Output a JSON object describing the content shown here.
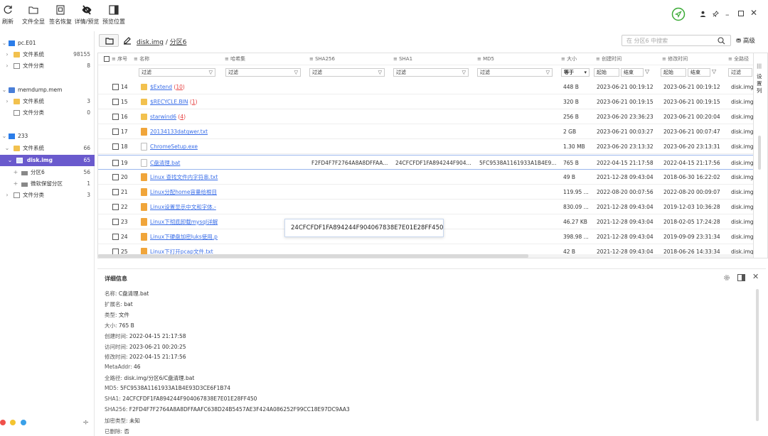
{
  "toolbar": {
    "refresh": "刷新",
    "expand_all": "文件全显",
    "signature_restore": "签名恢复",
    "details_preview": "详情/预览",
    "preview_position": "预览位置"
  },
  "sidebar": {
    "evidence": [
      {
        "name": "pc.E01",
        "children": [
          {
            "label": "文件系统",
            "count": "98155"
          },
          {
            "label": "文件分类",
            "count": "8"
          }
        ]
      },
      {
        "name": "memdump.mem",
        "children": [
          {
            "label": "文件系统",
            "count": "3"
          },
          {
            "label": "文件分类",
            "count": "0"
          }
        ]
      },
      {
        "name": "233",
        "children": [
          {
            "label": "文件系统",
            "count": "66"
          },
          {
            "label": "disk.img",
            "count": "65"
          },
          {
            "label": "分区6",
            "count": "56"
          },
          {
            "label": "微软保留分区",
            "count": "1"
          },
          {
            "label": "文件分类",
            "count": "3"
          }
        ]
      }
    ]
  },
  "path": {
    "root": "disk.img",
    "sep": " / ",
    "current": "分区6"
  },
  "search": {
    "placeholder": "在 分区6 中搜索",
    "advanced": "高级"
  },
  "grid": {
    "columns": [
      "序号",
      "名称",
      "哈希集",
      "SHA256",
      "SHA1",
      "MD5",
      "大小",
      "创建时间",
      "修改时间",
      "全路径"
    ],
    "side_label": "设置列",
    "filters": {
      "text": "过滤",
      "equals": "等于",
      "start": "起始",
      "end": "结束"
    },
    "rows": [
      {
        "no": "14",
        "name": "$Extend",
        "count": "10",
        "type": "folder",
        "sha256": "",
        "sha1": "",
        "md5": "",
        "size": "448 B",
        "created": "2023-06-21 00:19:12",
        "modified": "2023-06-21 00:19:12",
        "path": "disk.img"
      },
      {
        "no": "15",
        "name": "$RECYCLE.BIN",
        "count": "1",
        "type": "folder",
        "sha256": "",
        "sha1": "",
        "md5": "",
        "size": "320 B",
        "created": "2023-06-21 00:19:15",
        "modified": "2023-06-21 00:19:15",
        "path": "disk.img"
      },
      {
        "no": "16",
        "name": "starwind6",
        "count": "4",
        "type": "folder",
        "sha256": "",
        "sha1": "",
        "md5": "",
        "size": "256 B",
        "created": "2023-06-20 23:36:23",
        "modified": "2023-06-21 00:20:04",
        "path": "disk.img"
      },
      {
        "no": "17",
        "name": "20134133datqwer.txt",
        "count": "",
        "type": "file",
        "sha256": "",
        "sha1": "",
        "md5": "",
        "size": "2 GB",
        "created": "2023-06-21 00:03:27",
        "modified": "2023-06-21 00:07:47",
        "path": "disk.img"
      },
      {
        "no": "18",
        "name": "ChromeSetup.exe",
        "count": "",
        "type": "blank",
        "sha256": "",
        "sha1": "",
        "md5": "",
        "size": "1.30 MB",
        "created": "2023-06-20 23:13:32",
        "modified": "2023-06-20 23:13:31",
        "path": "disk.img"
      },
      {
        "no": "19",
        "name": "C盘清理.bat",
        "count": "",
        "type": "blank",
        "sha256": "F2FD4F7F2764A8A8DFFAA...",
        "sha1": "24CFCFDF1FA894244F904...",
        "md5": "5FC9538A1161933A1B4E9...",
        "size": "765 B",
        "created": "2022-04-15 21:17:58",
        "modified": "2022-04-15 21:17:56",
        "path": "disk.img"
      },
      {
        "no": "20",
        "name": "Linux 查找文件内字符串.txt",
        "count": "",
        "type": "file",
        "sha256": "",
        "sha1": "",
        "md5": "",
        "size": "49 B",
        "created": "2021-12-28 09:43:04",
        "modified": "2018-06-30 16:22:02",
        "path": "disk.img"
      },
      {
        "no": "21",
        "name": "Linux分配home容量给根目",
        "count": "",
        "type": "file",
        "sha256": "",
        "sha1": "",
        "md5": "",
        "size": "119.95 ...",
        "created": "2022-08-20 00:07:56",
        "modified": "2022-08-20 00:09:07",
        "path": "disk.img"
      },
      {
        "no": "22",
        "name": "Linux设置显示中文和字体.-",
        "count": "",
        "type": "file",
        "sha256": "",
        "sha1": "",
        "md5": "",
        "size": "830.09 ...",
        "created": "2021-12-28 09:43:04",
        "modified": "2019-12-03 10:36:28",
        "path": "disk.img"
      },
      {
        "no": "23",
        "name": "Linux下彻底卸载mysql详解",
        "count": "",
        "type": "file",
        "sha256": "",
        "sha1": "",
        "md5": "",
        "size": "46.27 KB",
        "created": "2021-12-28 09:43:04",
        "modified": "2018-02-05 17:24:28",
        "path": "disk.img"
      },
      {
        "no": "24",
        "name": "Linux下硬盘加密luks使用.p",
        "count": "",
        "type": "file",
        "sha256": "",
        "sha1": "",
        "md5": "",
        "size": "398.98 ...",
        "created": "2021-12-28 09:43:04",
        "modified": "2019-09-09 23:31:34",
        "path": "disk.img"
      },
      {
        "no": "25",
        "name": "Linux下打开pcap文件.txt",
        "count": "",
        "type": "file",
        "sha256": "",
        "sha1": "",
        "md5": "",
        "size": "42 B",
        "created": "2021-12-28 09:43:04",
        "modified": "2018-06-26 14:33:34",
        "path": "disk.img"
      }
    ]
  },
  "tooltip": "24CFCFDF1FA894244F904067838E7E01E28FF450",
  "detail": {
    "title": "详细信息",
    "lines": [
      {
        "k": "名称: ",
        "v": "C盘清理.bat"
      },
      {
        "k": "扩展名: ",
        "v": "bat"
      },
      {
        "k": "类型: ",
        "v": "文件"
      },
      {
        "k": "大小: ",
        "v": "765 B"
      },
      {
        "k": "创建时间: ",
        "v": "2022-04-15 21:17:58"
      },
      {
        "k": "访问时间: ",
        "v": "2023-06-21 00:20:25"
      },
      {
        "k": "修改时间: ",
        "v": "2022-04-15 21:17:56"
      },
      {
        "k": "MetaAddr: ",
        "v": "46"
      },
      {
        "k": "全路径: ",
        "v": "disk.img/分区6/C盘清理.bat"
      },
      {
        "k": "MD5: ",
        "v": "5FC9538A1161933A1B4E93D3CE6F1B74"
      },
      {
        "k": "SHA1: ",
        "v": "24CFCFDF1FA894244F904067838E7E01E28FF450"
      },
      {
        "k": "SHA256: ",
        "v": "F2FD4F7F2764A8A8DFFAAFC638D24B5457AE3F424A086252F99CC18E97DC9AA3"
      },
      {
        "k": "加密类型: ",
        "v": "未知"
      },
      {
        "k": "已删除: ",
        "v": "否"
      }
    ]
  },
  "colors": {
    "accent": "#6a5acd",
    "link": "#3a6ee8",
    "folder": "#f2c14e",
    "status_green": "#3aaa35"
  }
}
